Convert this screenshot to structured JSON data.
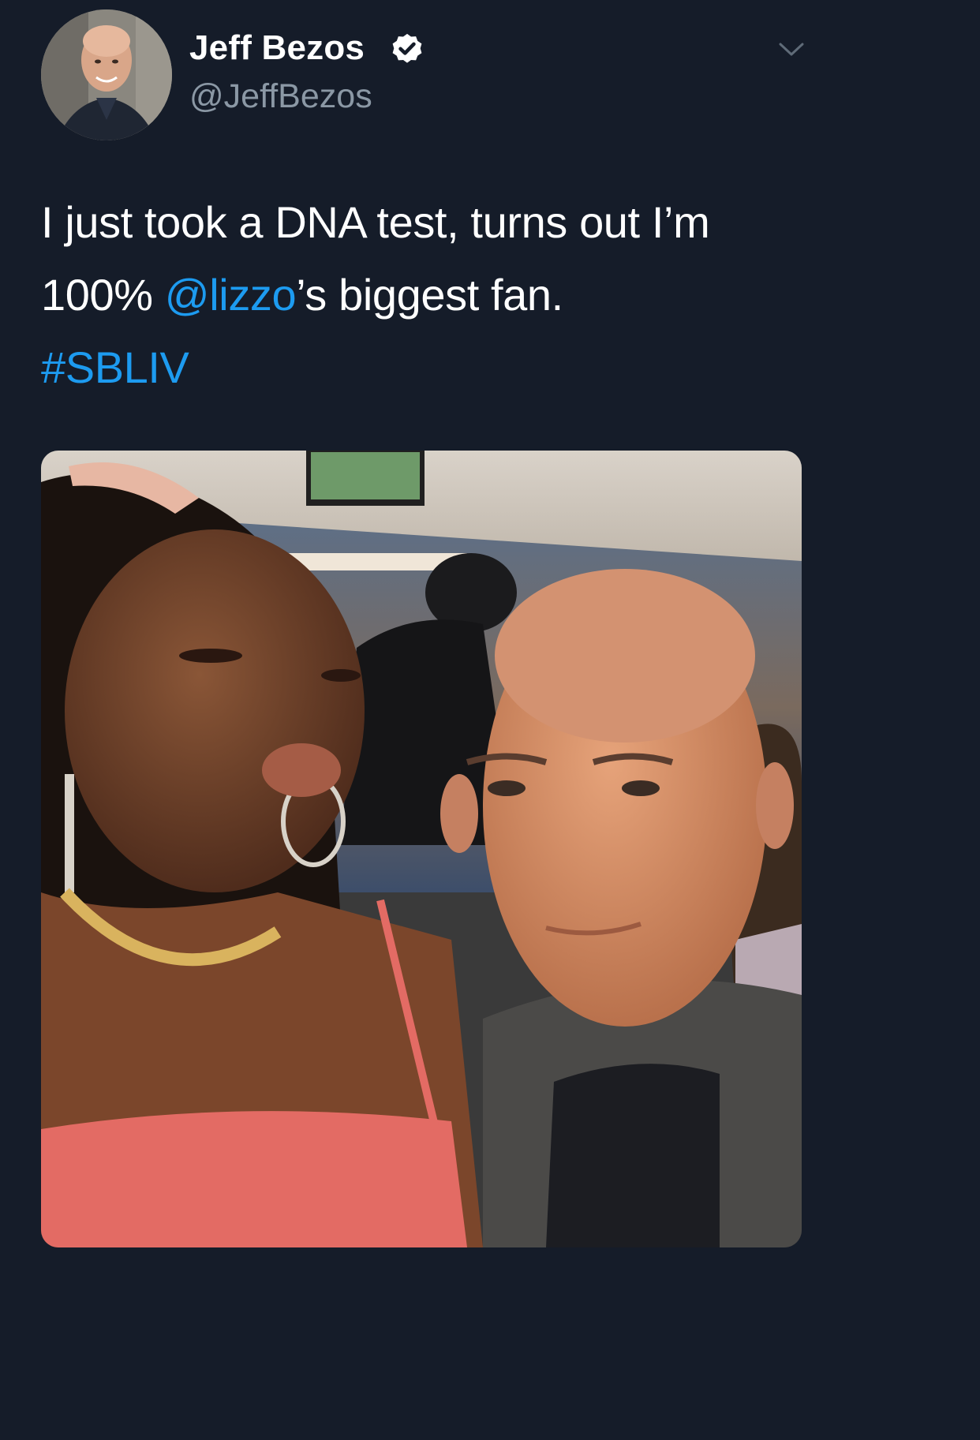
{
  "author": {
    "display_name": "Jeff Bezos",
    "handle": "@JeffBezos",
    "verified": true,
    "avatar_icon": "profile-photo"
  },
  "tweet": {
    "text_line1": "I just took a DNA test, turns out I’m",
    "text_prefix": "100% ",
    "mention": "@lizzo",
    "text_suffix": "’s biggest fan.",
    "hashtag": "#SBLIV"
  },
  "media": {
    "icon": "photo-selfie"
  },
  "controls": {
    "more_icon": "chevron-down-icon"
  },
  "colors": {
    "background": "#151c29",
    "link": "#1d9bf0",
    "handle": "#8b98a5"
  }
}
